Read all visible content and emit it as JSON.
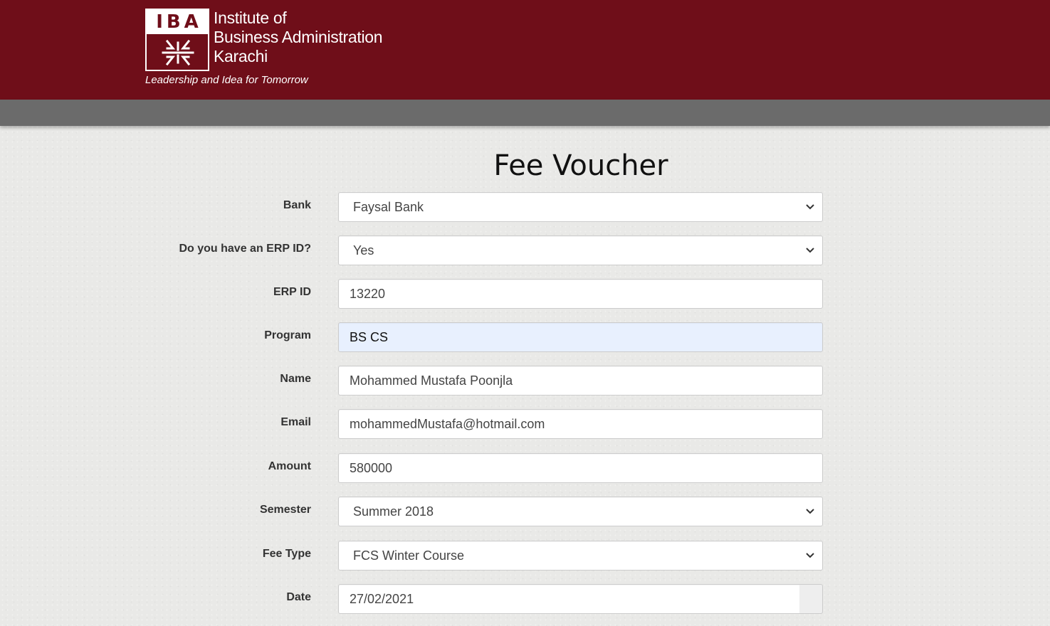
{
  "header": {
    "logo_abbrev": "IBA",
    "logo_lines": [
      "Institute of",
      "Business Administration",
      "Karachi"
    ],
    "tagline": "Leadership and Idea for Tomorrow",
    "bg_color": "#6f0e19",
    "nav_color": "#6b6b6b"
  },
  "form": {
    "title": "Fee Voucher",
    "fields": {
      "bank": {
        "label": "Bank",
        "value": "Faysal Bank",
        "type": "select"
      },
      "has_erp": {
        "label": "Do you have an ERP ID?",
        "value": "Yes",
        "type": "select"
      },
      "erp_id": {
        "label": "ERP ID",
        "value": "13220",
        "type": "text"
      },
      "program": {
        "label": "Program",
        "value": "BS CS",
        "type": "text-readonly"
      },
      "name": {
        "label": "Name",
        "value": "Mohammed Mustafa Poonjla",
        "type": "text"
      },
      "email": {
        "label": "Email",
        "value": "mohammedMustafa@hotmail.com",
        "type": "text"
      },
      "amount": {
        "label": "Amount",
        "value": "580000",
        "type": "text"
      },
      "semester": {
        "label": "Semester",
        "value": "Summer 2018",
        "type": "select"
      },
      "fee_type": {
        "label": "Fee Type",
        "value": "FCS Winter Course",
        "type": "select"
      },
      "date": {
        "label": "Date",
        "value": "27/02/2021",
        "type": "date"
      }
    }
  },
  "icons": {
    "select_arrow": "chevron-down-icon",
    "logo_mark": "iba-emblem-icon",
    "date_picker": "calendar-addon"
  }
}
